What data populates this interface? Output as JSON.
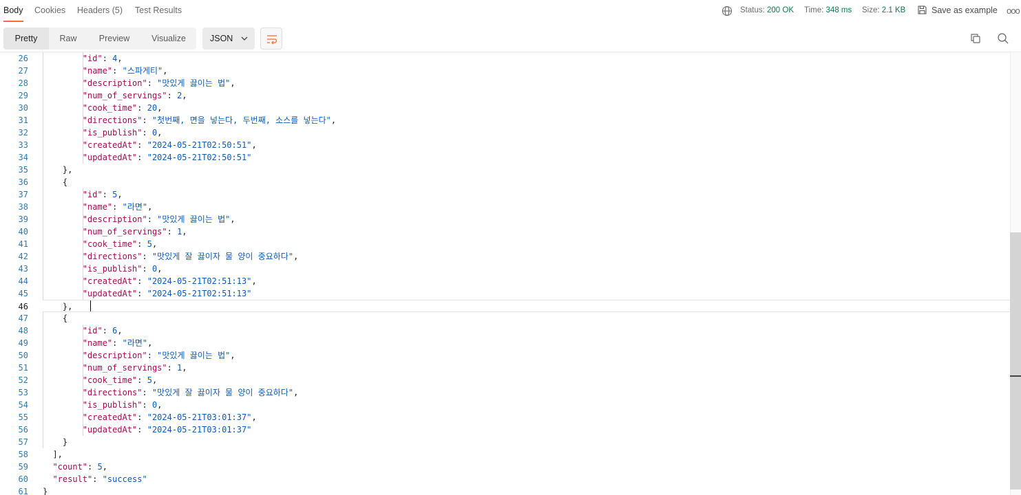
{
  "tabs": [
    {
      "label": "Body"
    },
    {
      "label": "Cookies"
    },
    {
      "label": "Headers (5)"
    },
    {
      "label": "Test Results"
    }
  ],
  "meta": {
    "status_label": "Status:",
    "status_value": "200 OK",
    "time_label": "Time:",
    "time_value": "348 ms",
    "size_label": "Size:",
    "size_value": "2.1 KB",
    "save_example": "Save as example",
    "more": "ooo"
  },
  "toolbar": {
    "views": [
      "Pretty",
      "Raw",
      "Preview",
      "Visualize"
    ],
    "format": "JSON"
  },
  "colors": {
    "accent": "#ff6c37",
    "status_ok": "#0a7c50",
    "json_key": "#9c0d52",
    "json_value": "#0b5bb5",
    "line_number": "#2b7bb5"
  },
  "code": {
    "current_line": 46,
    "lines": [
      {
        "n": "26",
        "t": "        \"id\": 4,"
      },
      {
        "n": "27",
        "t": "        \"name\": \"스파게티\","
      },
      {
        "n": "28",
        "t": "        \"description\": \"맛있게 끓이는 법\","
      },
      {
        "n": "29",
        "t": "        \"num_of_servings\": 2,"
      },
      {
        "n": "30",
        "t": "        \"cook_time\": 20,"
      },
      {
        "n": "31",
        "t": "        \"directions\": \"첫번째, 면을 넣는다, 두번째, 소스를 넣는다\","
      },
      {
        "n": "32",
        "t": "        \"is_publish\": 0,"
      },
      {
        "n": "33",
        "t": "        \"createdAt\": \"2024-05-21T02:50:51\","
      },
      {
        "n": "34",
        "t": "        \"updatedAt\": \"2024-05-21T02:50:51\""
      },
      {
        "n": "35",
        "t": "    },"
      },
      {
        "n": "36",
        "t": "    {"
      },
      {
        "n": "37",
        "t": "        \"id\": 5,"
      },
      {
        "n": "38",
        "t": "        \"name\": \"라면\","
      },
      {
        "n": "39",
        "t": "        \"description\": \"맛있게 끓이는 법\","
      },
      {
        "n": "40",
        "t": "        \"num_of_servings\": 1,"
      },
      {
        "n": "41",
        "t": "        \"cook_time\": 5,"
      },
      {
        "n": "42",
        "t": "        \"directions\": \"맛있게 잘 끓이자 물 양이 중요하다\","
      },
      {
        "n": "43",
        "t": "        \"is_publish\": 0,"
      },
      {
        "n": "44",
        "t": "        \"createdAt\": \"2024-05-21T02:51:13\","
      },
      {
        "n": "45",
        "t": "        \"updatedAt\": \"2024-05-21T02:51:13\""
      },
      {
        "n": "46",
        "t": "    },"
      },
      {
        "n": "47",
        "t": "    {"
      },
      {
        "n": "48",
        "t": "        \"id\": 6,"
      },
      {
        "n": "49",
        "t": "        \"name\": \"라면\","
      },
      {
        "n": "50",
        "t": "        \"description\": \"맛있게 끓이는 법\","
      },
      {
        "n": "51",
        "t": "        \"num_of_servings\": 1,"
      },
      {
        "n": "52",
        "t": "        \"cook_time\": 5,"
      },
      {
        "n": "53",
        "t": "        \"directions\": \"맛있게 잘 끓이자 물 양이 중요하다\","
      },
      {
        "n": "54",
        "t": "        \"is_publish\": 0,"
      },
      {
        "n": "55",
        "t": "        \"createdAt\": \"2024-05-21T03:01:37\","
      },
      {
        "n": "56",
        "t": "        \"updatedAt\": \"2024-05-21T03:01:37\""
      },
      {
        "n": "57",
        "t": "    }"
      },
      {
        "n": "58",
        "t": "  ],"
      },
      {
        "n": "59",
        "t": "  \"count\": 5,"
      },
      {
        "n": "60",
        "t": "  \"result\": \"success\""
      },
      {
        "n": "61",
        "t": "}"
      }
    ]
  }
}
